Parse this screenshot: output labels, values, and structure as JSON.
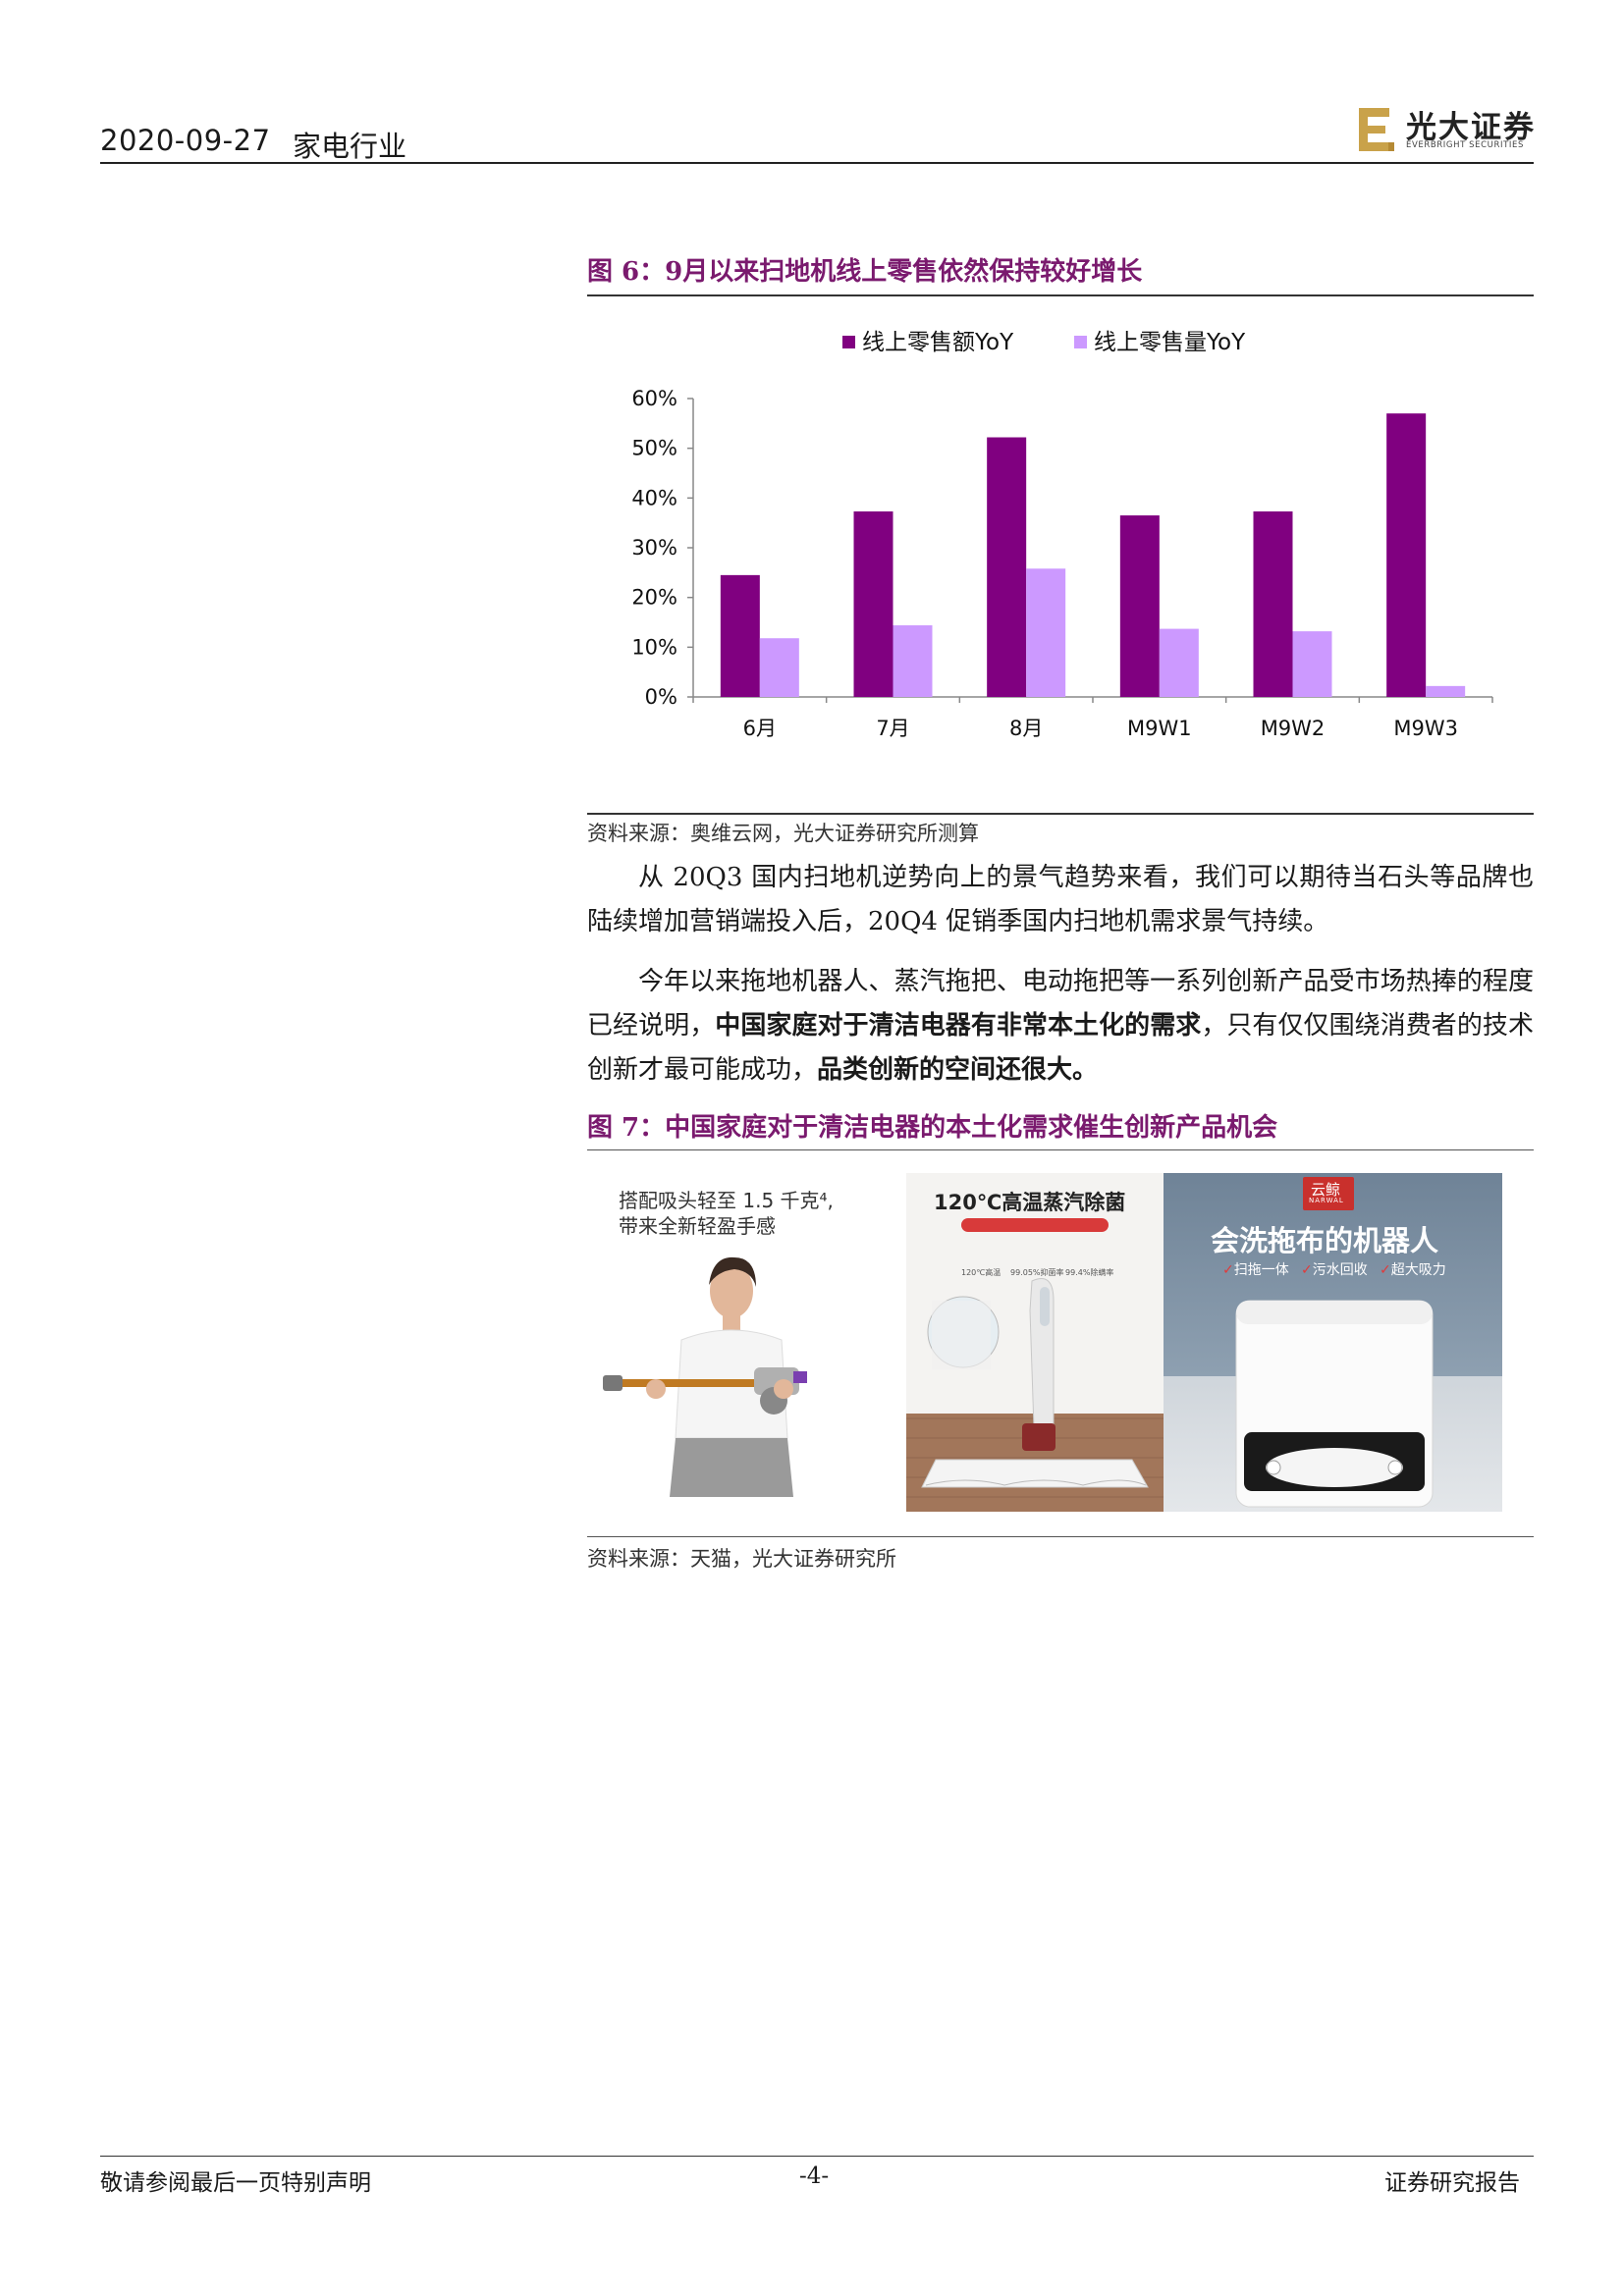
{
  "header": {
    "date": "2020-09-27",
    "industry": "家电行业",
    "logo_cn": "光大证券",
    "logo_en": "EVERBRIGHT SECURITIES",
    "logo_color": "#c9a24a"
  },
  "figure6": {
    "title": "图 6：9月以来扫地机线上零售依然保持较好增长",
    "source": "资料来源：奥维云网，光大证券研究所测算"
  },
  "chart_data": {
    "type": "bar",
    "title": "",
    "xlabel": "",
    "ylabel": "",
    "categories": [
      "6月",
      "7月",
      "8月",
      "M9W1",
      "M9W2",
      "M9W3"
    ],
    "series": [
      {
        "name": "线上零售额YoY",
        "color": "#800080",
        "values": [
          24.5,
          37.3,
          52.2,
          36.5,
          37.3,
          57.0
        ]
      },
      {
        "name": "线上零售量YoY",
        "color": "#cc99ff",
        "values": [
          11.8,
          14.4,
          25.8,
          13.7,
          13.2,
          2.2
        ]
      }
    ],
    "ylim": [
      0,
      60
    ],
    "yticks": [
      "0%",
      "10%",
      "20%",
      "30%",
      "40%",
      "50%",
      "60%"
    ],
    "grid": false,
    "legend": "top-center"
  },
  "body": {
    "para1": "从 20Q3 国内扫地机逆势向上的景气趋势来看，我们可以期待当石头等品牌也陆续增加营销端投入后，20Q4 促销季国内扫地机需求景气持续。",
    "para2_a": "今年以来拖地机器人、蒸汽拖把、电动拖把等一系列创新产品受市场热捧的程度已经说明，",
    "para2_b": "中国家庭对于清洁电器有非常本土化的需求",
    "para2_c": "，只有仅仅围绕消费者的技术创新才最可能成功，",
    "para2_d": "品类创新的空间还很大。"
  },
  "figure7": {
    "title": "图 7：中国家庭对于清洁电器的本土化需求催生创新产品机会",
    "source": "资料来源：天猫，光大证券研究所",
    "dyson_line1": "搭配吸头轻至 1.5 千克⁴,",
    "dyson_line2": "带来全新轻盈手感",
    "steam_title": "120℃高温蒸汽除菌",
    "steam_stat1": "120℃高温",
    "steam_stat2": "99.05%抑菌率",
    "steam_stat3": "99.4%除螨率",
    "narwal_brand_cn": "云鲸",
    "narwal_brand_en": "NARWAL",
    "narwal_title": "会洗拖布的机器人",
    "narwal_f1": "扫拖一体",
    "narwal_f2": "污水回收",
    "narwal_f3": "超大吸力"
  },
  "footer": {
    "left": "敬请参阅最后一页特别声明",
    "page": "-4-",
    "right": "证券研究报告"
  }
}
